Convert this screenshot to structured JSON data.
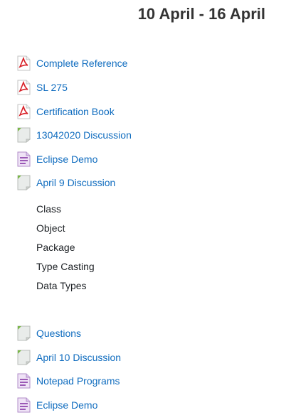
{
  "section": {
    "title": "10 April - 16 April"
  },
  "activities_top": [
    {
      "label": "Complete Reference",
      "icon": "pdf-icon"
    },
    {
      "label": "SL 275",
      "icon": "pdf-icon"
    },
    {
      "label": "Certification Book",
      "icon": "pdf-icon"
    },
    {
      "label": "13042020 Discussion",
      "icon": "file-icon"
    },
    {
      "label": "Eclipse Demo",
      "icon": "document-icon"
    },
    {
      "label": "April 9 Discussion",
      "icon": "file-icon"
    }
  ],
  "topics": [
    "Class",
    "Object",
    "Package",
    "Type Casting",
    "Data Types"
  ],
  "activities_bottom": [
    {
      "label": "Questions",
      "icon": "file-icon"
    },
    {
      "label": "April 10 Discussion",
      "icon": "file-icon"
    },
    {
      "label": "Notepad Programs",
      "icon": "document-icon"
    },
    {
      "label": "Eclipse Demo",
      "icon": "document-icon"
    }
  ],
  "colors": {
    "link": "#0f6cbf",
    "title": "#333333",
    "text": "#1d2125",
    "pdf_red": "#d81f26",
    "file_green": "#7ab648",
    "doc_purple": "#9b59b6"
  }
}
